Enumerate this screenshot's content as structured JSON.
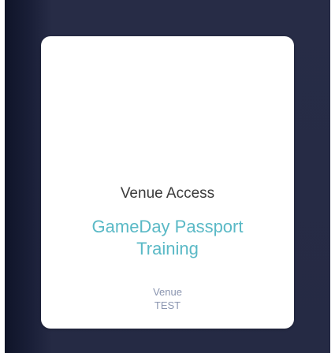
{
  "card": {
    "title": "Venue Access",
    "organization_line1": "GameDay Passport",
    "organization_line2": "Training",
    "venue_label": "Venue",
    "venue_value": "TEST"
  },
  "colors": {
    "background": "#262b45",
    "card": "#ffffff",
    "accent": "#5ab9c6",
    "title_text": "#3b3b3b",
    "muted_text": "#8a95b0"
  }
}
